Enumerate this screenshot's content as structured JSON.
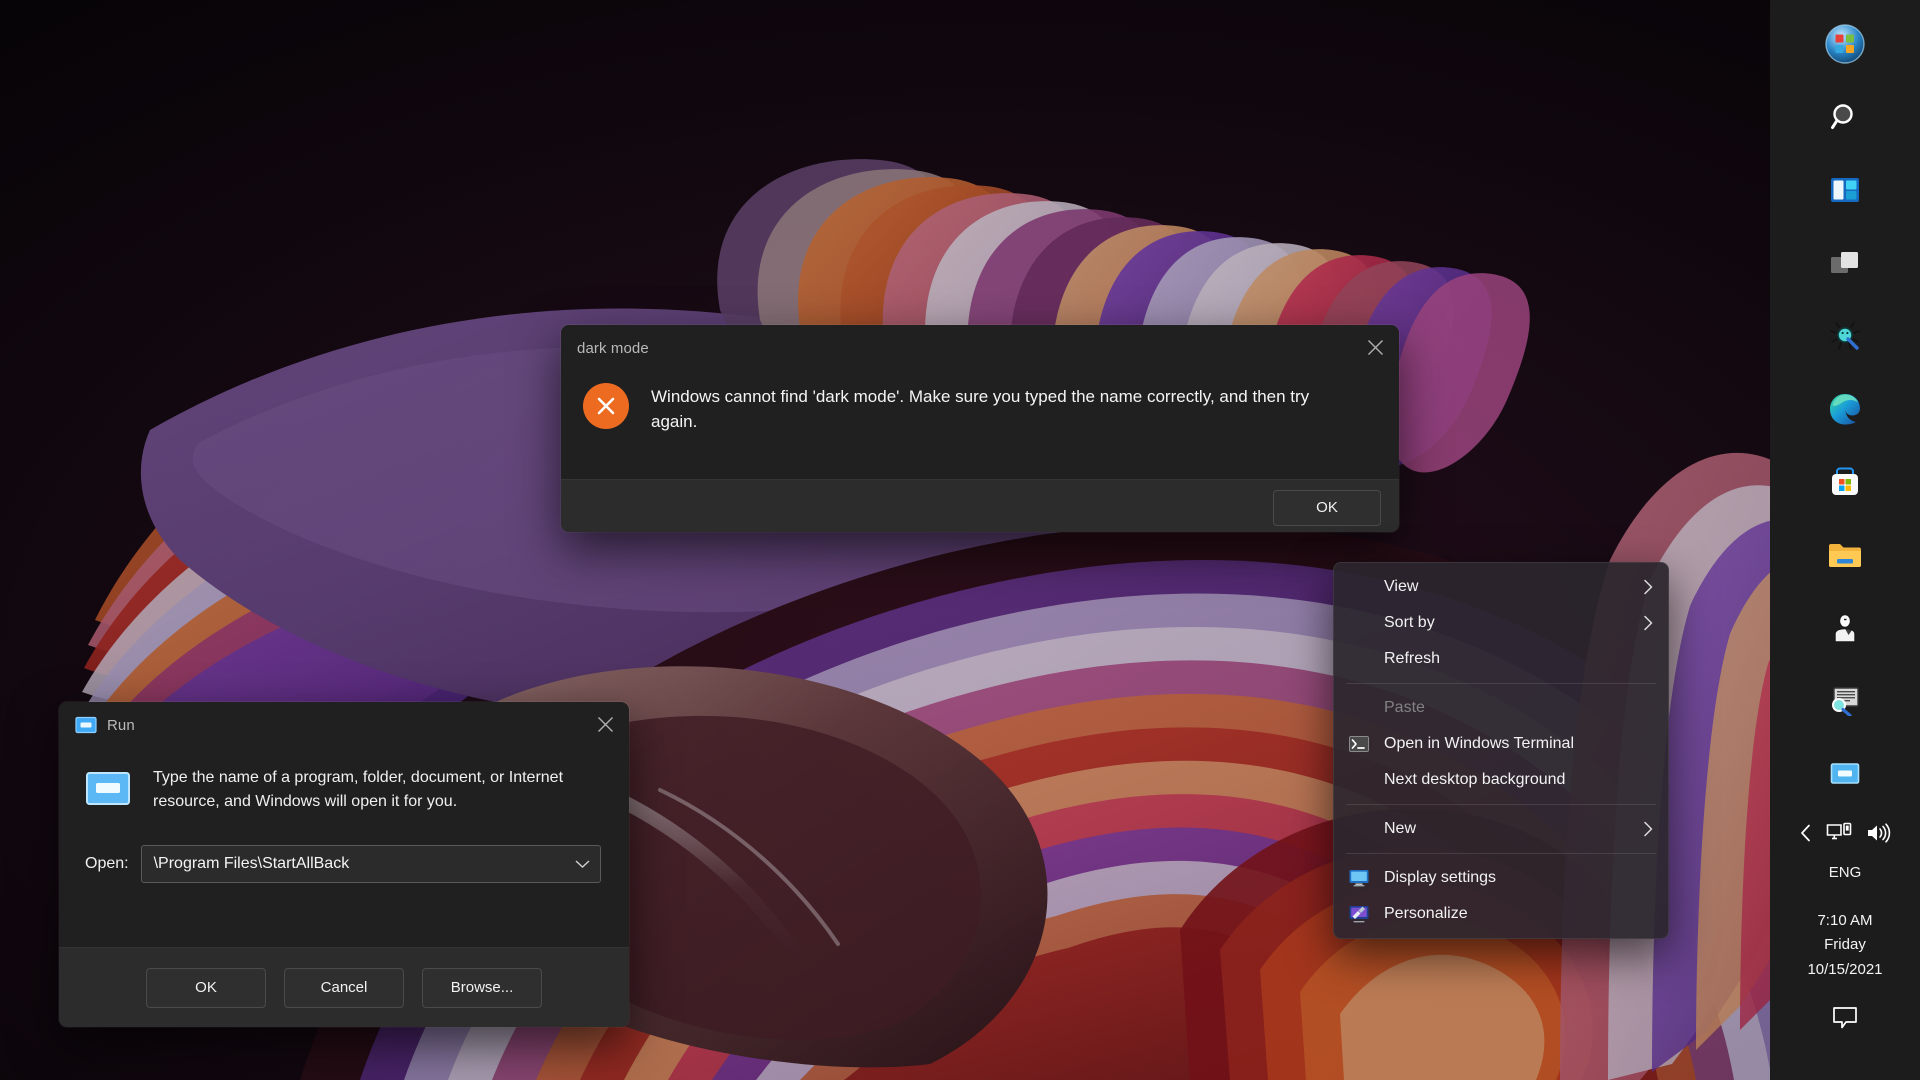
{
  "desktop": {
    "wallpaper_name": "windows-11-flow-abstract-ribbons",
    "background_color": "#0a0608"
  },
  "error_dialog": {
    "title": "dark mode",
    "close_icon": "close-icon",
    "error_icon": "error-x-icon",
    "accent_color": "#ed6b21",
    "message": "Windows cannot find 'dark mode'. Make sure you typed the name correctly, and then try again.",
    "ok_label": "OK"
  },
  "run_dialog": {
    "title": "Run",
    "app_icon": "run-app-icon",
    "close_icon": "close-icon",
    "description": "Type the name of a program, folder, document, or Internet resource, and Windows will open it for you.",
    "open_label": "Open:",
    "open_value": "\\Program Files\\StartAllBack",
    "open_placeholder": "",
    "chevron_icon": "chevron-down-icon",
    "buttons": {
      "ok": "OK",
      "cancel": "Cancel",
      "browse": "Browse..."
    }
  },
  "context_menu": {
    "items": [
      {
        "label": "View",
        "icon": "",
        "submenu": true,
        "disabled": false
      },
      {
        "label": "Sort by",
        "icon": "",
        "submenu": true,
        "disabled": false
      },
      {
        "label": "Refresh",
        "icon": "",
        "submenu": false,
        "disabled": false
      },
      {
        "label": "Paste",
        "icon": "",
        "submenu": false,
        "disabled": true
      },
      {
        "label": "Open in Windows Terminal",
        "icon": "terminal-icon",
        "submenu": false,
        "disabled": false
      },
      {
        "label": "Next desktop background",
        "icon": "",
        "submenu": false,
        "disabled": false
      },
      {
        "label": "New",
        "icon": "",
        "submenu": true,
        "disabled": false
      },
      {
        "label": "Display settings",
        "icon": "display-icon",
        "submenu": false,
        "disabled": false
      },
      {
        "label": "Personalize",
        "icon": "personalize-icon",
        "submenu": false,
        "disabled": false
      }
    ]
  },
  "taskbar": {
    "items": [
      {
        "name": "start-button",
        "icon": "windows-orb-icon"
      },
      {
        "name": "search-button",
        "icon": "search-icon"
      },
      {
        "name": "widgets-button",
        "icon": "widgets-icon"
      },
      {
        "name": "task-view-button",
        "icon": "task-view-icon"
      },
      {
        "name": "spider-app",
        "icon": "spider-icon"
      },
      {
        "name": "edge-browser",
        "icon": "edge-icon"
      },
      {
        "name": "microsoft-store",
        "icon": "store-icon"
      },
      {
        "name": "file-explorer",
        "icon": "folder-icon"
      },
      {
        "name": "user-app",
        "icon": "person-icon"
      },
      {
        "name": "legacy-search-app",
        "icon": "monitor-search-icon"
      },
      {
        "name": "run-taskbar-item",
        "icon": "run-app-icon"
      }
    ]
  },
  "system_tray": {
    "chevron_icon": "chevron-left-icon",
    "network_icon": "network-icon",
    "volume_icon": "volume-icon",
    "language": "ENG",
    "time": "7:10 AM",
    "day": "Friday",
    "date": "10/15/2021",
    "chat_icon": "chat-icon"
  }
}
